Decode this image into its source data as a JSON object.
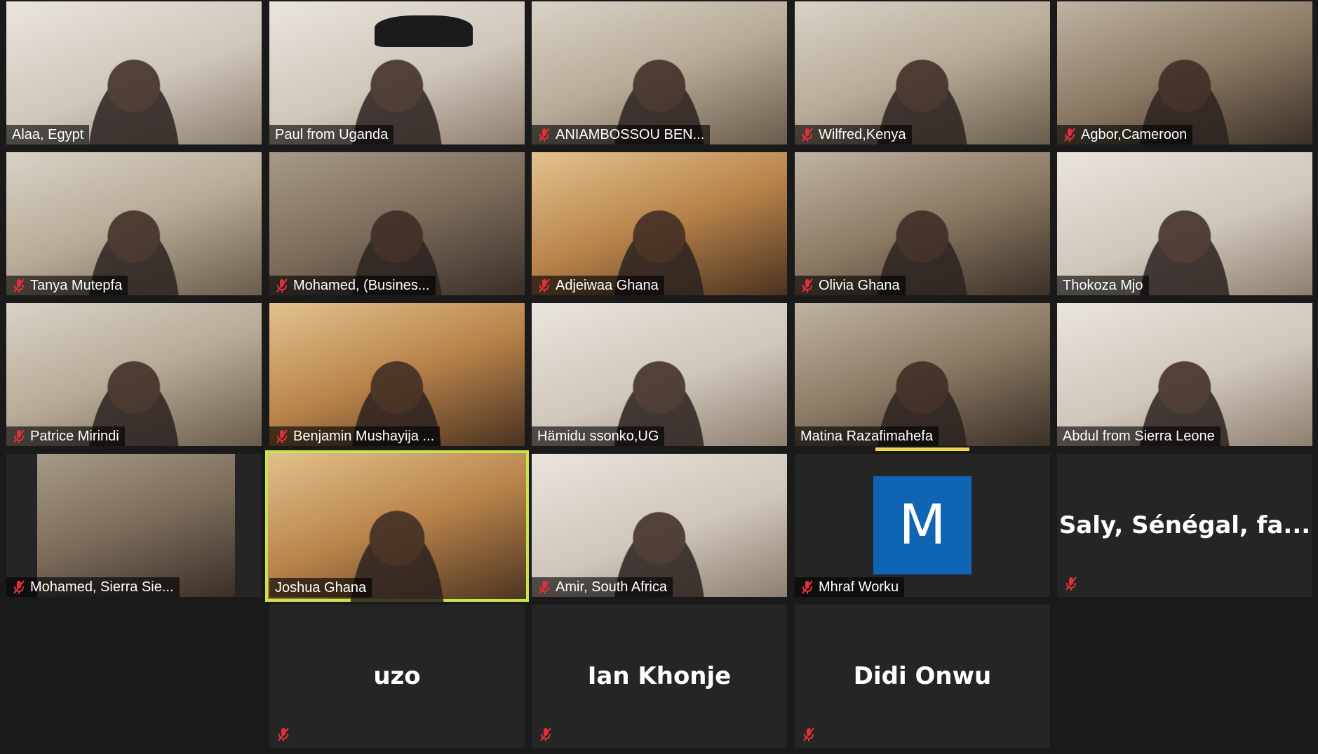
{
  "meeting": {
    "participants": [
      {
        "name": "Alaa, Egypt",
        "muted": false,
        "video": true
      },
      {
        "name": "Paul from Uganda",
        "muted": false,
        "video": true
      },
      {
        "name": "ANIAMBOSSOU BEN...",
        "muted": true,
        "video": true
      },
      {
        "name": "Wilfred,Kenya",
        "muted": true,
        "video": true
      },
      {
        "name": "Agbor,Cameroon",
        "muted": true,
        "video": true
      },
      {
        "name": "Tanya Mutepfa",
        "muted": true,
        "video": true
      },
      {
        "name": "Mohamed,  (Busines...",
        "muted": true,
        "video": true
      },
      {
        "name": "Adjeiwaa Ghana",
        "muted": true,
        "video": true
      },
      {
        "name": "Olivia Ghana",
        "muted": true,
        "video": true
      },
      {
        "name": "Thokoza Mjo",
        "muted": false,
        "video": true
      },
      {
        "name": "Patrice Mirindi",
        "muted": true,
        "video": true
      },
      {
        "name": "Benjamin Mushayija ...",
        "muted": true,
        "video": true
      },
      {
        "name": "Hämidu ssonko,UG",
        "muted": false,
        "video": true
      },
      {
        "name": "Matina Razafimahefa",
        "muted": false,
        "video": true
      },
      {
        "name": "Abdul from Sierra Leone",
        "muted": false,
        "video": true
      },
      {
        "name": "Mohamed, Sierra Sie...",
        "muted": true,
        "video": true
      },
      {
        "name": "Joshua Ghana",
        "muted": false,
        "video": true,
        "speaking": true
      },
      {
        "name": "Amir, South Africa",
        "muted": true,
        "video": true
      },
      {
        "name": "Mhraf Worku",
        "muted": true,
        "video": false,
        "avatar_letter": "M"
      },
      {
        "name": "Saly, Sénégal, fa...",
        "muted": true,
        "video": false
      },
      {
        "name": "uzo",
        "muted": true,
        "video": false
      },
      {
        "name": "Ian Khonje",
        "muted": true,
        "video": false
      },
      {
        "name": "Didi Onwu",
        "muted": true,
        "video": false
      }
    ]
  },
  "colors": {
    "background": "#1a1a1a",
    "tile_bg": "#252525",
    "active_speaker": "#c9e34a",
    "avatar_bg": "#0f64b4",
    "muted_icon": "#e0303a",
    "name_text": "#ffffff"
  }
}
